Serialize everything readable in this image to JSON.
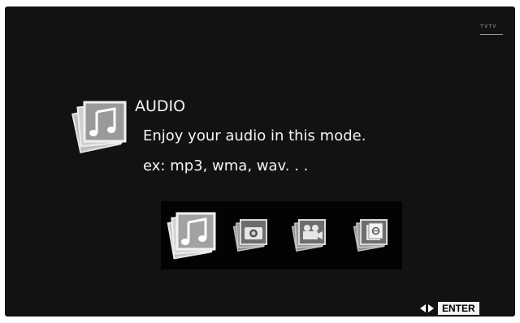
{
  "header": {
    "brand_mark": "ᴛᴠᴛᴠ"
  },
  "selected_mode": {
    "title": "AUDIO",
    "description": "Enjoy your audio in this mode.",
    "examples": "ex: mp3, wma, wav. . ."
  },
  "modes": [
    {
      "id": "audio",
      "icon": "music-note-icon",
      "selected": true
    },
    {
      "id": "photo",
      "icon": "photo-camera-icon",
      "selected": false
    },
    {
      "id": "video",
      "icon": "video-camera-icon",
      "selected": false
    },
    {
      "id": "ebook",
      "icon": "ebook-icon",
      "selected": false
    }
  ],
  "footer": {
    "enter_label": "ENTER"
  },
  "colors": {
    "background": "#121212",
    "text": "#f4f4f4",
    "bar": "#030303"
  }
}
